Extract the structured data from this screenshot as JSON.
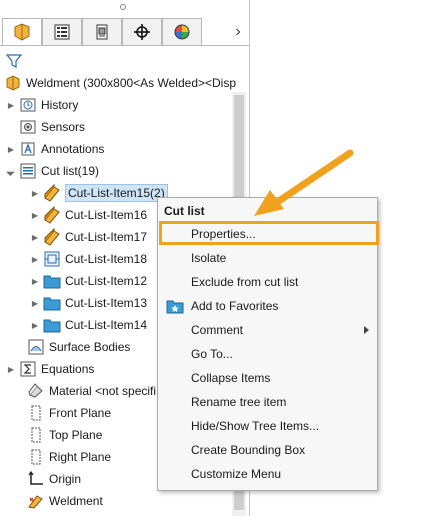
{
  "tabs": [
    {
      "name": "feature-manager-icon"
    },
    {
      "name": "property-manager-icon"
    },
    {
      "name": "configuration-manager-icon"
    },
    {
      "name": "dimxpert-manager-icon"
    },
    {
      "name": "display-manager-icon"
    }
  ],
  "tree": {
    "root_label": "Weldment  (300x800<As Welded><Disp",
    "items": [
      {
        "label": "History",
        "icon": "history-icon"
      },
      {
        "label": "Sensors",
        "icon": "sensors-icon"
      },
      {
        "label": "Annotations",
        "icon": "annotations-icon"
      },
      {
        "label": "Cut list(19)",
        "icon": "cut-list-icon"
      },
      {
        "label": "Cut-List-Item15(2)",
        "icon": "weldment-item-icon"
      },
      {
        "label": "Cut-List-Item16",
        "icon": "weldment-item-icon"
      },
      {
        "label": "Cut-List-Item17",
        "icon": "weldment-item-icon"
      },
      {
        "label": "Cut-List-Item18",
        "icon": "sheet-metal-item-icon"
      },
      {
        "label": "Cut-List-Item12",
        "icon": "folder-icon"
      },
      {
        "label": "Cut-List-Item13",
        "icon": "folder-icon"
      },
      {
        "label": "Cut-List-Item14",
        "icon": "folder-icon"
      },
      {
        "label": "Surface Bodies",
        "icon": "surface-bodies-icon"
      },
      {
        "label": "Equations",
        "icon": "equations-icon"
      },
      {
        "label": "Material <not specifi",
        "icon": "material-icon"
      },
      {
        "label": "Front Plane",
        "icon": "plane-icon"
      },
      {
        "label": "Top Plane",
        "icon": "plane-icon"
      },
      {
        "label": "Right Plane",
        "icon": "plane-icon"
      },
      {
        "label": "Origin",
        "icon": "origin-icon"
      },
      {
        "label": "Weldment",
        "icon": "weldment-icon"
      }
    ]
  },
  "context_menu": {
    "title": "Cut list",
    "items": [
      {
        "label": "Properties..."
      },
      {
        "label": "Isolate"
      },
      {
        "label": "Exclude from cut list"
      },
      {
        "label": "Add to Favorites"
      },
      {
        "label": "Comment"
      },
      {
        "label": "Go To..."
      },
      {
        "label": "Collapse Items"
      },
      {
        "label": "Rename tree item"
      },
      {
        "label": "Hide/Show Tree Items..."
      },
      {
        "label": "Create Bounding Box"
      },
      {
        "label": "Customize Menu"
      }
    ]
  },
  "colors": {
    "highlight": "#f0a11e",
    "selection": "#cfe4f7",
    "folder": "#3a9bd5"
  }
}
